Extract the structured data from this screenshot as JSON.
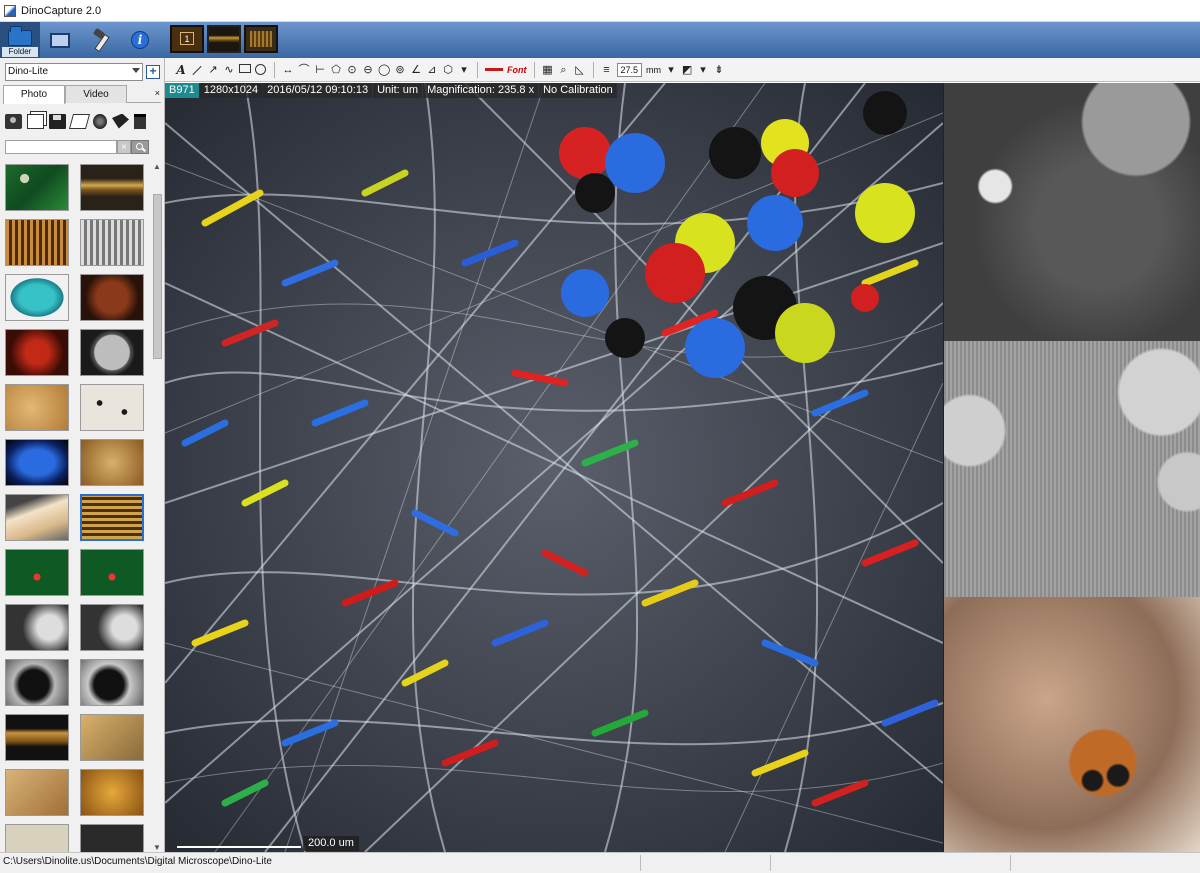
{
  "window": {
    "title": "DinoCapture 2.0"
  },
  "main_toolbar": {
    "folder_label": "Folder"
  },
  "camera_tabs": [
    {
      "label": "1"
    }
  ],
  "sidebar": {
    "device": {
      "value": "Dino-Lite"
    },
    "tabs": [
      {
        "label": "Photo"
      },
      {
        "label": "Video"
      }
    ]
  },
  "viewer": {
    "info": {
      "model": "B971",
      "resolution": "1280x1024",
      "datetime": "2016/05/12 09:10:13",
      "unit": "Unit: um",
      "magnification": "Magnification:  235.8 x",
      "calibration": "No Calibration"
    },
    "scale": "200.0 um"
  },
  "image_toolbar": {
    "text_tool": "A",
    "font_label": "Font",
    "line_width": "27.5",
    "unit": "mm"
  },
  "status": {
    "path": "C:\\Users\\Dinolite.us\\Documents\\Digital Microscope\\Dino-Lite"
  }
}
